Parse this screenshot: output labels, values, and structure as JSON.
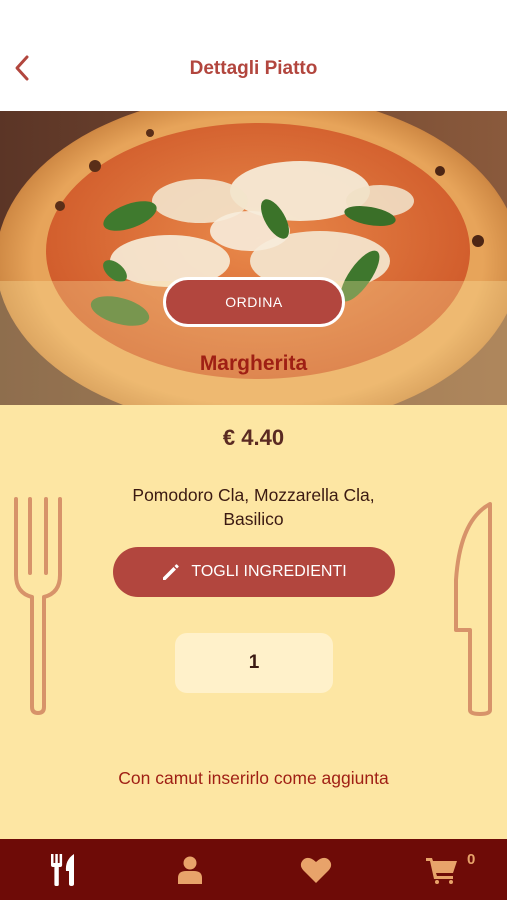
{
  "header": {
    "title": "Dettagli Piatto",
    "back_icon": "chevron-left-icon"
  },
  "hero": {
    "image": "pizza-margherita-photo",
    "order_label": "ORDINA",
    "dish_name": "Margherita"
  },
  "details": {
    "price": "€ 4.40",
    "ingredients": "Pomodoro Cla, Mozzarella Cla, Basilico",
    "remove_label": "TOGLI INGREDIENTI",
    "remove_icon": "pencil-icon",
    "quantity": "1",
    "note": "Con camut inserirlo come aggiunta"
  },
  "tabbar": {
    "items": [
      {
        "name": "menu",
        "icon": "fork-knife-icon"
      },
      {
        "name": "profile",
        "icon": "user-icon"
      },
      {
        "name": "favorites",
        "icon": "heart-icon"
      },
      {
        "name": "cart",
        "icon": "cart-icon"
      }
    ],
    "cart_count": "0"
  },
  "colors": {
    "accent": "#b2463e",
    "dish_name": "#9f1f14",
    "panel": "#fde6a3",
    "tabbar": "#6e0b07",
    "tab_icon": "#e8a36a",
    "tab_icon_active": "#ffffff"
  }
}
